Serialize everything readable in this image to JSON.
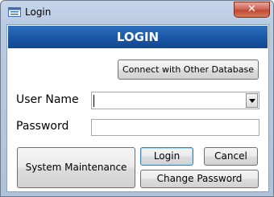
{
  "window": {
    "title": "Login",
    "close_glyph": "✕"
  },
  "banner": {
    "title": "LOGIN"
  },
  "buttons": {
    "connect": "Connect with Other Database",
    "system_maintenance": "System Maintenance",
    "login": "Login",
    "cancel": "Cancel",
    "change_password": "Change Password"
  },
  "form": {
    "username_label": "User Name",
    "username_value": "",
    "password_label": "Password",
    "password_value": ""
  },
  "colors": {
    "banner": "#1c58a8",
    "close": "#c24a36",
    "frame": "#b9cbe3"
  }
}
